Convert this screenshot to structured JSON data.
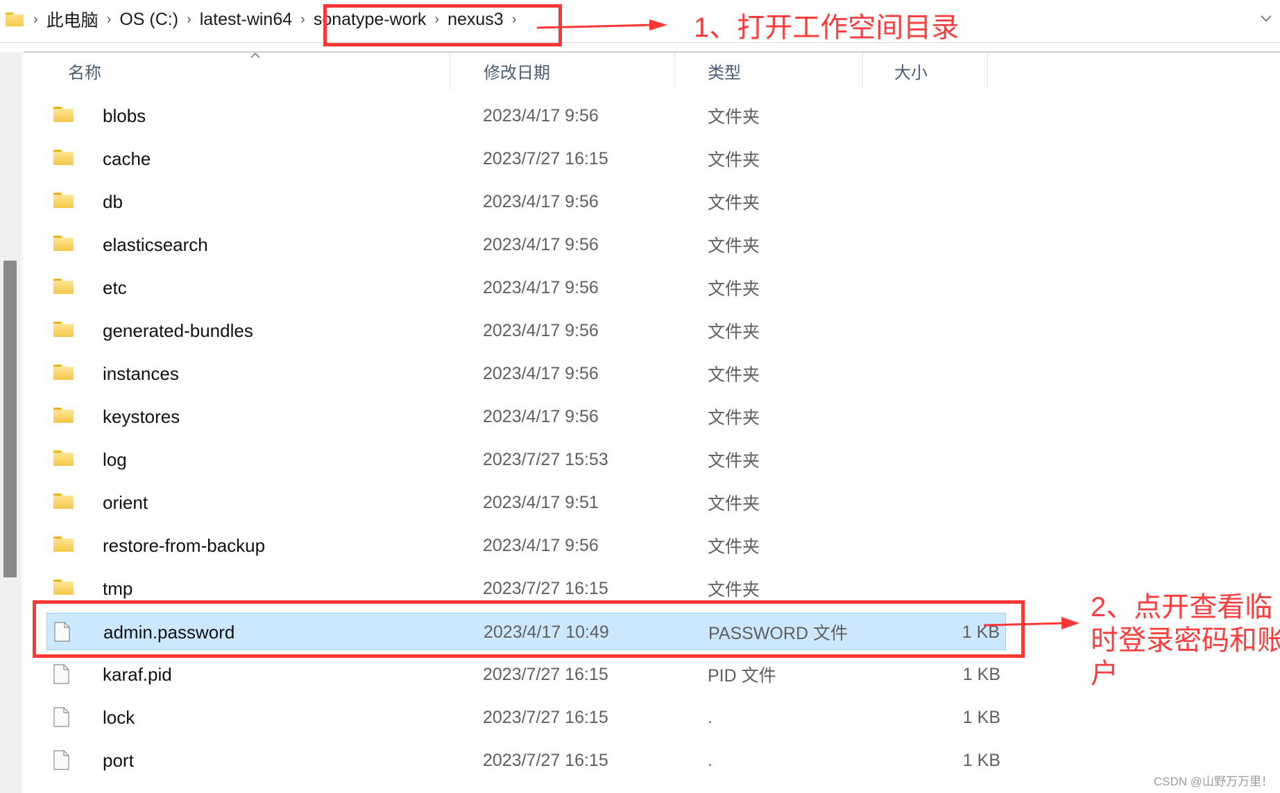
{
  "address_bar": {
    "crumbs": [
      "此电脑",
      "OS (C:)",
      "latest-win64",
      "sonatype-work",
      "nexus3"
    ],
    "icons": {
      "location": "folder-icon",
      "separator": "chevron-right-icon",
      "history": "chevron-down-icon"
    }
  },
  "columns": {
    "name": "名称",
    "date": "修改日期",
    "type": "类型",
    "size": "大小",
    "sort": {
      "column": "name",
      "direction": "ascending",
      "icon": "sort-up-caret-icon"
    }
  },
  "files": [
    {
      "name": "blobs",
      "date": "2023/4/17 9:56",
      "type": "文件夹",
      "size": "",
      "kind": "folder"
    },
    {
      "name": "cache",
      "date": "2023/7/27 16:15",
      "type": "文件夹",
      "size": "",
      "kind": "folder"
    },
    {
      "name": "db",
      "date": "2023/4/17 9:56",
      "type": "文件夹",
      "size": "",
      "kind": "folder"
    },
    {
      "name": "elasticsearch",
      "date": "2023/4/17 9:56",
      "type": "文件夹",
      "size": "",
      "kind": "folder"
    },
    {
      "name": "etc",
      "date": "2023/4/17 9:56",
      "type": "文件夹",
      "size": "",
      "kind": "folder"
    },
    {
      "name": "generated-bundles",
      "date": "2023/4/17 9:56",
      "type": "文件夹",
      "size": "",
      "kind": "folder"
    },
    {
      "name": "instances",
      "date": "2023/4/17 9:56",
      "type": "文件夹",
      "size": "",
      "kind": "folder"
    },
    {
      "name": "keystores",
      "date": "2023/4/17 9:56",
      "type": "文件夹",
      "size": "",
      "kind": "folder"
    },
    {
      "name": "log",
      "date": "2023/7/27 15:53",
      "type": "文件夹",
      "size": "",
      "kind": "folder"
    },
    {
      "name": "orient",
      "date": "2023/4/17 9:51",
      "type": "文件夹",
      "size": "",
      "kind": "folder"
    },
    {
      "name": "restore-from-backup",
      "date": "2023/4/17 9:56",
      "type": "文件夹",
      "size": "",
      "kind": "folder"
    },
    {
      "name": "tmp",
      "date": "2023/7/27 16:15",
      "type": "文件夹",
      "size": "",
      "kind": "folder"
    },
    {
      "name": "admin.password",
      "date": "2023/4/17 10:49",
      "type": "PASSWORD 文件",
      "size": "1 KB",
      "kind": "file",
      "selected": true
    },
    {
      "name": "karaf.pid",
      "date": "2023/7/27 16:15",
      "type": "PID 文件",
      "size": "1 KB",
      "kind": "file"
    },
    {
      "name": "lock",
      "date": "2023/7/27 16:15",
      "type": ".",
      "size": "1 KB",
      "kind": "file"
    },
    {
      "name": "port",
      "date": "2023/7/27 16:15",
      "type": ".",
      "size": "1 KB",
      "kind": "file"
    }
  ],
  "annotations": {
    "step1": "1、打开工作空间目录",
    "step2_lines": [
      "2、点开查看临",
      "时登录密码和账",
      "户"
    ],
    "color": "#ff3636"
  },
  "watermark": "CSDN @山野万万里！",
  "colors": {
    "selection_bg": "#cce8ff",
    "selection_border": "#99d1ff",
    "folder": "#f7c948",
    "header_text": "#4a5c72"
  }
}
